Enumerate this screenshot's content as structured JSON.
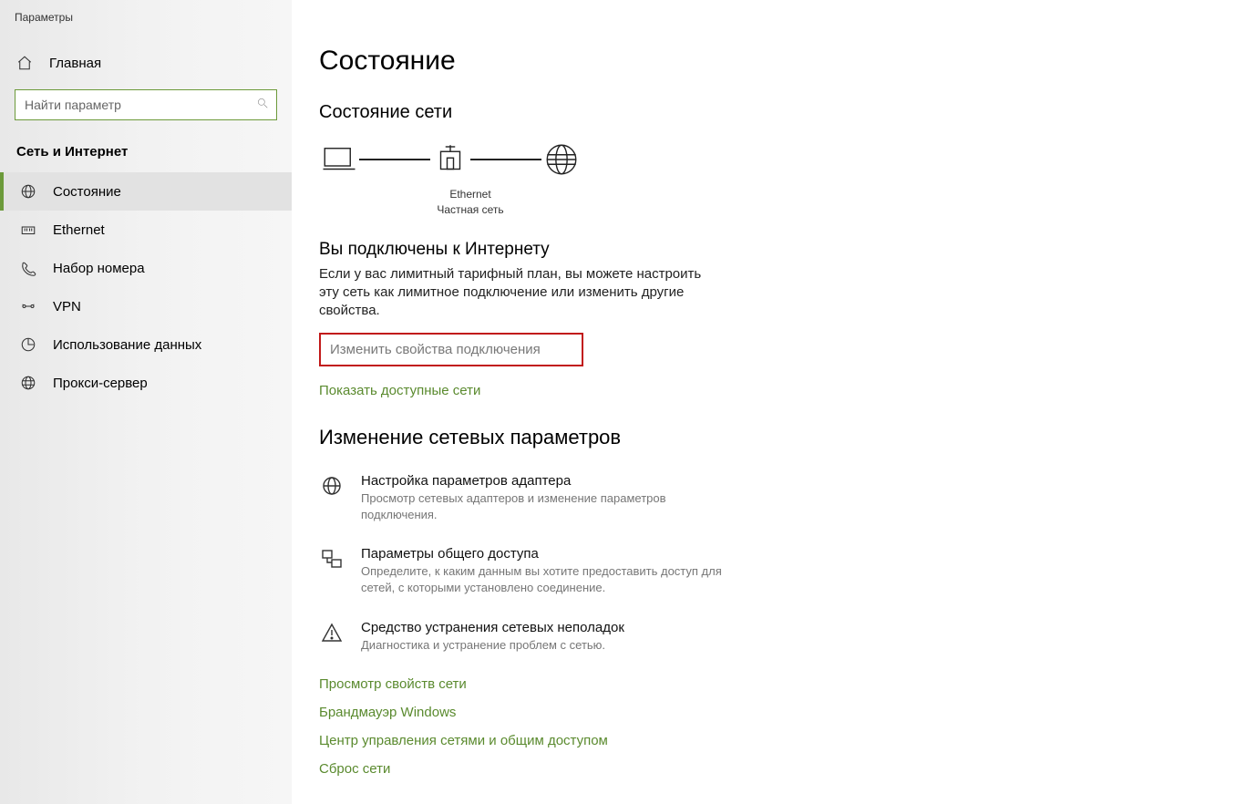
{
  "window_title": "Параметры",
  "sidebar": {
    "home_label": "Главная",
    "search_placeholder": "Найти параметр",
    "section_label": "Сеть и Интернет",
    "items": [
      {
        "label": "Состояние",
        "id": "status",
        "active": true
      },
      {
        "label": "Ethernet",
        "id": "ethernet",
        "active": false
      },
      {
        "label": "Набор номера",
        "id": "dialup",
        "active": false
      },
      {
        "label": "VPN",
        "id": "vpn",
        "active": false
      },
      {
        "label": "Использование данных",
        "id": "datausage",
        "active": false
      },
      {
        "label": "Прокси-сервер",
        "id": "proxy",
        "active": false
      }
    ]
  },
  "main": {
    "title": "Состояние",
    "network_status_heading": "Состояние сети",
    "diagram": {
      "adapter_name": "Ethernet",
      "network_type": "Частная сеть"
    },
    "connected_heading": "Вы подключены к Интернету",
    "connected_desc": "Если у вас лимитный тарифный план, вы можете настроить эту сеть как лимитное подключение или изменить другие свойства.",
    "change_props_link": "Изменить свойства подключения",
    "show_networks_link": "Показать доступные сети",
    "change_settings_heading": "Изменение сетевых параметров",
    "options": [
      {
        "title": "Настройка параметров адаптера",
        "desc": "Просмотр сетевых адаптеров и изменение параметров подключения."
      },
      {
        "title": "Параметры общего доступа",
        "desc": "Определите, к каким данным вы хотите предоставить доступ для сетей, с которыми установлено соединение."
      },
      {
        "title": "Средство устранения сетевых неполадок",
        "desc": "Диагностика и устранение проблем с сетью."
      }
    ],
    "bottom_links": [
      "Просмотр свойств сети",
      "Брандмауэр Windows",
      "Центр управления сетями и общим доступом",
      "Сброс сети"
    ]
  }
}
